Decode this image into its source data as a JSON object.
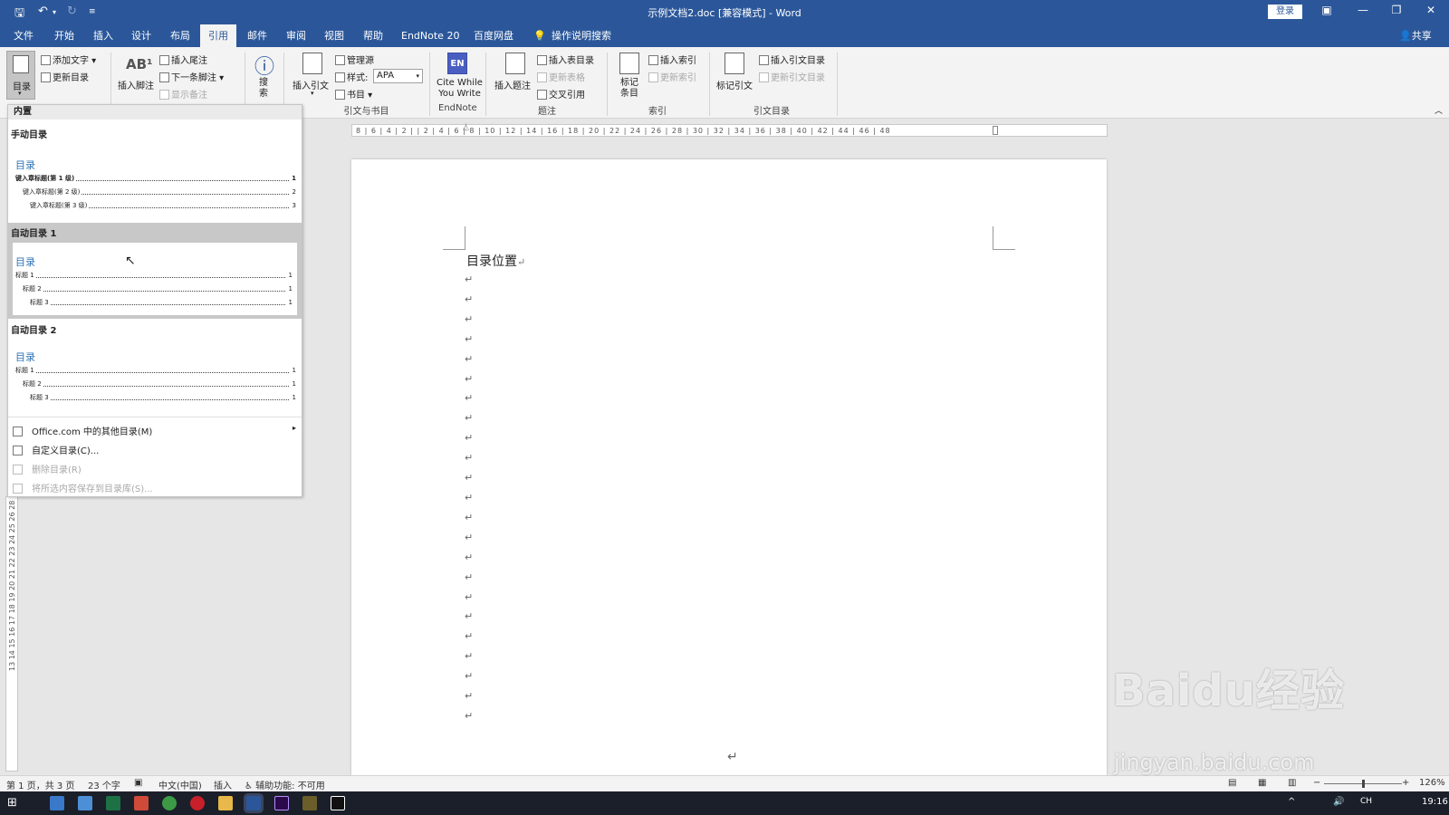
{
  "window": {
    "title": "示例文档2.doc [兼容模式] - Word",
    "login": "登录"
  },
  "tabs": [
    "文件",
    "开始",
    "插入",
    "设计",
    "布局",
    "引用",
    "邮件",
    "审阅",
    "视图",
    "帮助",
    "EndNote 20",
    "百度网盘",
    "操作说明搜索"
  ],
  "share": "共享",
  "ribbon": {
    "toc_label": "目录",
    "add_text": "添加文字",
    "update_toc": "更新目录",
    "insert_footnote": "插入脚注",
    "insert_endnote": "插入尾注",
    "next_footnote": "下一条脚注",
    "show_notes": "显示备注",
    "search_label": "搜索",
    "insert_citation": "插入引文",
    "manage_sources": "管理源",
    "style_label": "样式:",
    "style_value": "APA",
    "bibliography": "书目",
    "group_citations": "引文与书目",
    "cite_while_line1": "Cite While",
    "cite_while_line2": "You Write",
    "group_endnote": "EndNote",
    "insert_caption": "插入题注",
    "insert_table_figures": "插入表目录",
    "update_table": "更新表格",
    "cross_reference": "交叉引用",
    "group_captions": "题注",
    "mark_entry": "标记条目",
    "insert_index": "插入索引",
    "update_index": "更新索引",
    "group_index": "索引",
    "mark_citation": "标记引文",
    "insert_toa": "插入引文目录",
    "update_toa": "更新引文目录",
    "group_toa": "引文目录"
  },
  "gallery": {
    "builtin": "内置",
    "manual_title": "手动目录",
    "manual_heading": "目录",
    "manual_lines": [
      {
        "text": "键入章标题(第 1 级)",
        "page": "1"
      },
      {
        "text": "键入章标题(第 2 级)",
        "page": "2"
      },
      {
        "text": "键入章标题(第 3 级)",
        "page": "3"
      }
    ],
    "auto1_title": "自动目录 1",
    "auto1_heading": "目录",
    "auto2_title": "自动目录 2",
    "auto2_heading": "目录",
    "auto_lines": [
      {
        "text": "标题 1",
        "page": "1"
      },
      {
        "text": "标题 2",
        "page": "1"
      },
      {
        "text": "标题 3",
        "page": "1"
      }
    ],
    "menu_office": "Office.com 中的其他目录(M)",
    "menu_custom": "自定义目录(C)...",
    "menu_remove": "删除目录(R)",
    "menu_save": "将所选内容保存到目录库(S)..."
  },
  "ruler_numbers": "8 | 6 | 4 | 2 |  | 2 | 4 | 6 | 8 | 10 | 12 | 14 | 16 | 18 | 20 | 22 | 24 | 26 | 28 | 30 | 32 | 34 | 36 | 38 | 40 | 42 | 44 | 46 | 48",
  "vruler_numbers": "13 14 15 16 17 18 19 20 21 22 23 24 25 26 28",
  "document": {
    "heading": "目录位置",
    "para_mark": "↵"
  },
  "status": {
    "page": "第 1 页，共 3 页",
    "words": "23 个字",
    "language": "中文(中国)",
    "mode": "插入",
    "accessibility": "辅助功能: 不可用",
    "zoom": "126%"
  },
  "taskbar": {
    "ime": "CH",
    "time": "19:16"
  },
  "watermark": {
    "main": "Baidu经验",
    "sub": "jingyan.baidu.com"
  }
}
